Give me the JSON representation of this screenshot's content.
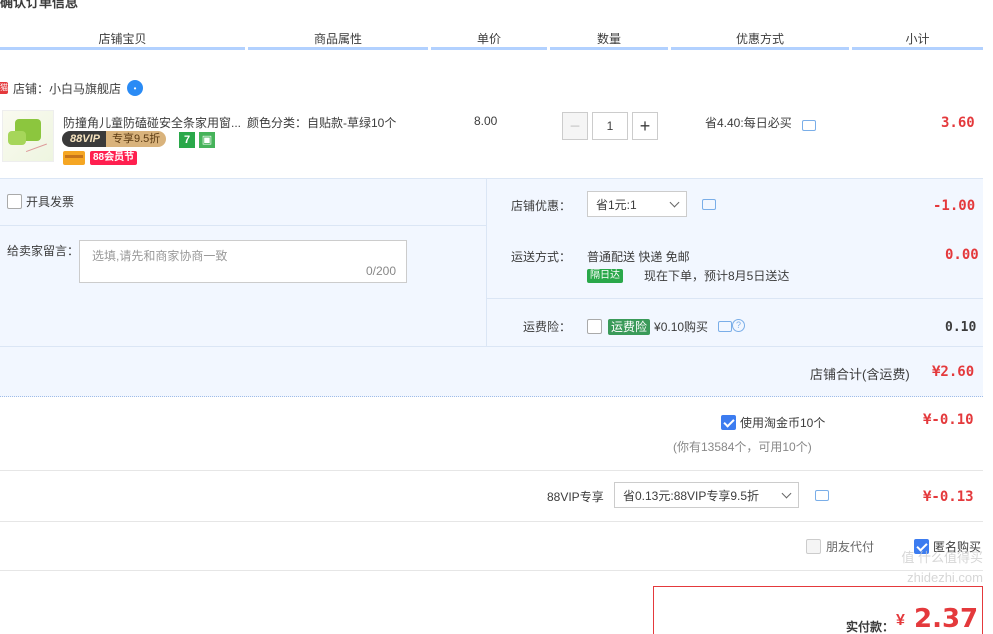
{
  "section_title": "确认订单信息",
  "columns": [
    "店铺宝贝",
    "商品属性",
    "单价",
    "数量",
    "优惠方式",
    "小计"
  ],
  "shop": {
    "icon": "tmall-icon",
    "label": "店铺：",
    "name": "小白马旗舰店"
  },
  "item": {
    "title": "防撞角儿童防磕碰安全条家用窗...",
    "attr": "颜色分类：自贴款-草绿10个",
    "vip_a": "88VIP",
    "vip_b": "专享9.5折",
    "icon_seven": "7",
    "badge": "88会员节",
    "unit_price": "8.00",
    "quantity": "1",
    "minus": "−",
    "plus": "+",
    "discount": "省4.40:每日必买",
    "subtotal": "3.60"
  },
  "invoice": {
    "label": "开具发票"
  },
  "remark": {
    "label": "给卖家留言：",
    "placeholder": "选填,请先和商家协商一致",
    "count": "0/200"
  },
  "shop_discount": {
    "label": "店铺优惠：",
    "value": "省1元:1",
    "amount": "-1.00"
  },
  "shipping": {
    "label": "运送方式：",
    "value": "普通配送 快递 免邮",
    "tag": "隔日达",
    "eta": "现在下单，预计8月5日送达",
    "amount": "0.00"
  },
  "insurance": {
    "label": "运费险：",
    "tag": "运费险",
    "price": "¥0.10购买",
    "amount": "0.10"
  },
  "shop_total": {
    "label": "店铺合计(含运费)",
    "amount": "¥2.60"
  },
  "coins": {
    "label": "使用淘金币10个",
    "note": "(你有13584个，可用10个)",
    "amount": "¥-0.10"
  },
  "vip": {
    "label": "88VIP专享",
    "value": "省0.13元:88VIP专享9.5折",
    "amount": "¥-0.13"
  },
  "options": {
    "friend_pay": "朋友代付",
    "anonymous": "匿名购买"
  },
  "payment": {
    "label": "实付款：",
    "currency": "¥",
    "amount": "2.37"
  },
  "watermark": "值 什么值得买 zhidezhi.com"
}
